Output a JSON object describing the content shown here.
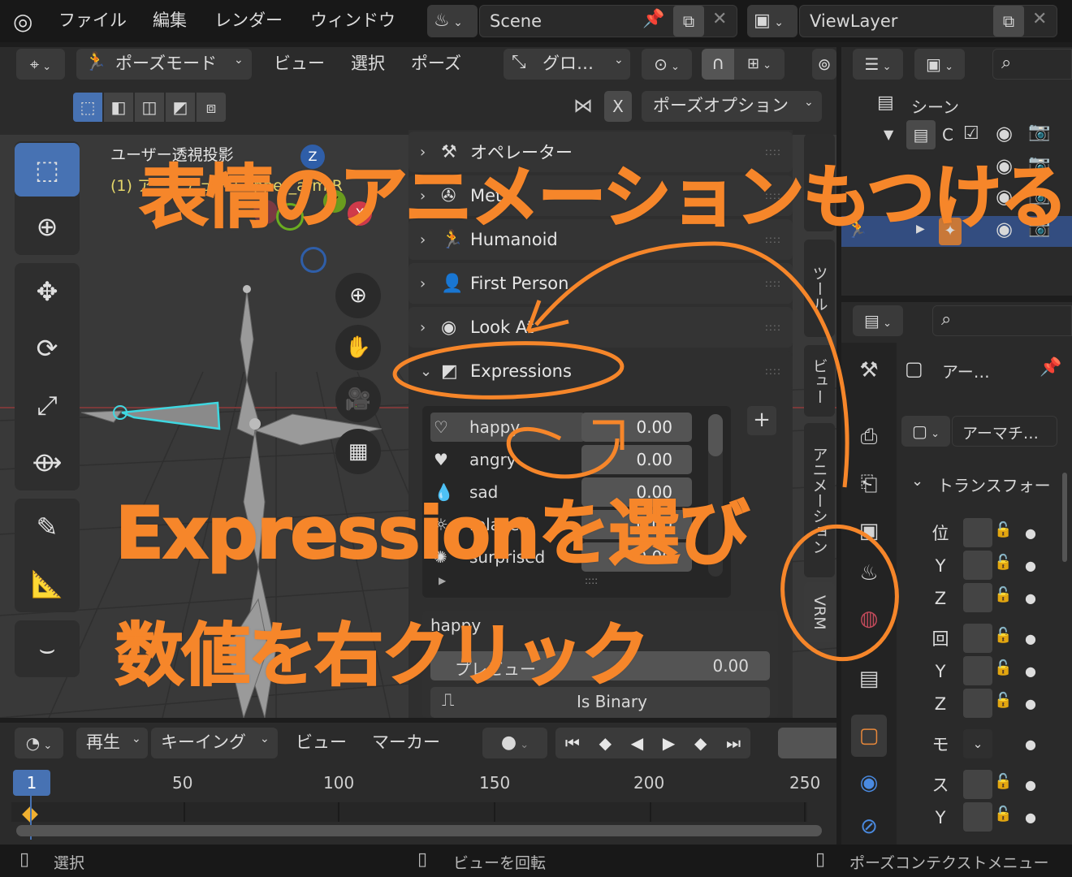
{
  "topbar": {
    "menus": [
      "ファイル",
      "編集",
      "レンダー",
      "ウィンドウ"
    ],
    "scene": "Scene",
    "view_layer": "ViewLayer"
  },
  "viewport_header": {
    "mode": "ポーズモード",
    "menus": [
      "ビュー",
      "選択",
      "ポーズ"
    ],
    "transform_orientation": "グロ…",
    "x_toggle": "X",
    "pose_options": "ポーズオプション"
  },
  "viewport": {
    "view_label": "ユーザー透視投影",
    "object_label": "(1) アーマチュア : upper_arm.R",
    "gizmo_labels": [
      "Z",
      "Y",
      "X"
    ]
  },
  "npanel": {
    "sections": [
      {
        "label": "オペレーター",
        "icon": "wrench-icon"
      },
      {
        "label": "Meta",
        "icon": "meta-icon"
      },
      {
        "label": "Humanoid",
        "icon": "humanoid-icon"
      },
      {
        "label": "First Person",
        "icon": "first-person-icon"
      },
      {
        "label": "Look At",
        "icon": "eye-icon"
      },
      {
        "label": "Expressions",
        "icon": "expressions-icon"
      }
    ],
    "expressions": [
      {
        "name": "happy",
        "value": "0.00"
      },
      {
        "name": "angry",
        "value": "0.00"
      },
      {
        "name": "sad",
        "value": "0.00"
      },
      {
        "name": "relaxed",
        "value": "0.00"
      },
      {
        "name": "surprised",
        "value": "0.00"
      }
    ],
    "selected_label": "happy",
    "preview_label": "プレビュー",
    "preview_value": "0.00",
    "is_binary": "Is Binary"
  },
  "sidebar_tabs": [
    "ツール",
    "ビュー",
    "アニメーション",
    "VRM"
  ],
  "timeline": {
    "menus": [
      "再生",
      "キーイング",
      "ビュー",
      "マーカー"
    ],
    "current_frame": "1",
    "ticks": [
      "50",
      "100",
      "150",
      "200",
      "250"
    ]
  },
  "statusbar": {
    "left": "選択",
    "middle": "ビューを回転",
    "right": "ポーズコンテクストメニュー"
  },
  "outliner": {
    "scene_label": "シーン",
    "collection_label": "C"
  },
  "properties": {
    "armature_label": "アー…",
    "armature_data": "アーマチ…",
    "transform_header": "トランスフォー",
    "rows": [
      "位",
      "Y",
      "Z",
      "回",
      "Y",
      "Z",
      "モ",
      "ス",
      "Y"
    ]
  },
  "annotations": {
    "headline": "表情のアニメーションもつける",
    "step1": "Expressionを選び",
    "step2": "数値を右クリック"
  },
  "colors": {
    "annotation": "#f6862a",
    "accent_blue": "#4772b3",
    "selected_bone": "#3fd7e0"
  }
}
